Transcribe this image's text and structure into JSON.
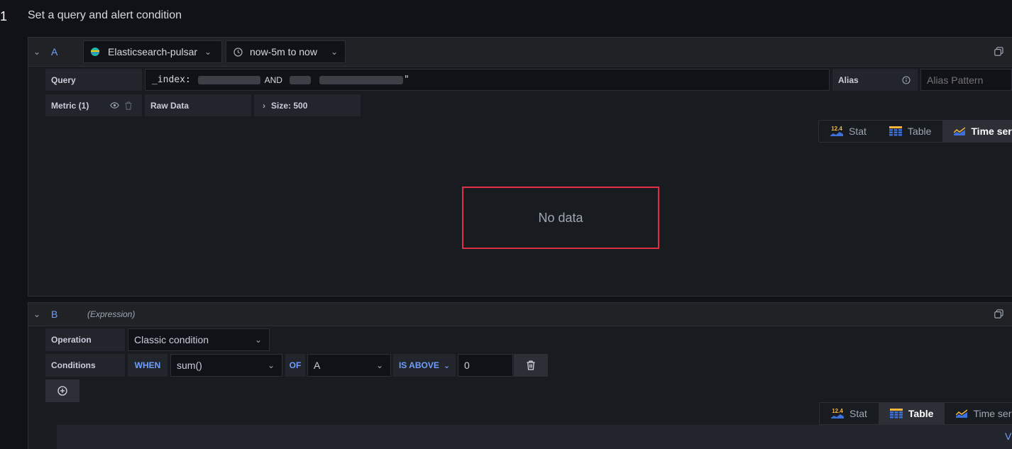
{
  "step": {
    "number": "1",
    "title": "Set a query and alert condition"
  },
  "query_a": {
    "ref_id": "A",
    "datasource": "Elasticsearch-pulsar",
    "time_range": "now-5m to now",
    "query_label": "Query",
    "query_prefix": "_index: ",
    "query_mid": "AND",
    "query_suffix": "\"",
    "alias_label": "Alias",
    "alias_placeholder": "Alias Pattern",
    "metric_label": "Metric (1)",
    "metric_value": "Raw Data",
    "size_label": "Size: 500",
    "empty_message": "No data"
  },
  "viz_a": [
    {
      "label": "Stat",
      "badge": "12.4",
      "active": false
    },
    {
      "label": "Table",
      "active": false
    },
    {
      "label": "Time series",
      "active": true
    }
  ],
  "expr_b": {
    "ref_id": "B",
    "type_label": "(Expression)",
    "operation_label": "Operation",
    "operation_value": "Classic condition",
    "conditions_label": "Conditions",
    "when": "WHEN",
    "func": "sum()",
    "of": "OF",
    "query_ref": "A",
    "evaluator": "IS ABOVE",
    "threshold": "0"
  },
  "viz_b": [
    {
      "label": "Stat",
      "badge": "12.4",
      "active": false
    },
    {
      "label": "Table",
      "active": true
    },
    {
      "label": "Time series",
      "active": false
    }
  ],
  "bottom_partial_text": "V",
  "colors": {
    "background": "#111217",
    "panel": "#181b1f",
    "accent": "#6e9fff",
    "highlight_border": "#e02f44"
  }
}
